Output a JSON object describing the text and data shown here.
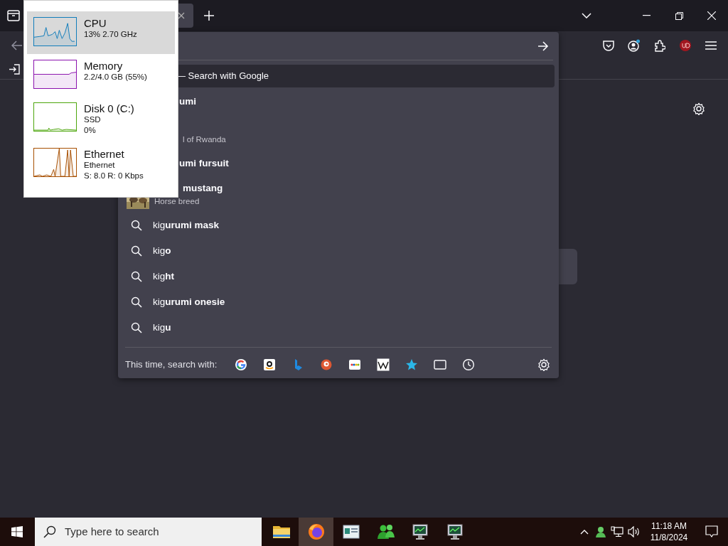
{
  "address_dropdown": {
    "heading": "— Search with Google",
    "results": [
      {
        "kind": "partial",
        "title": "umi"
      },
      {
        "kind": "partial",
        "subtitle": "l of Rwanda"
      },
      {
        "kind": "partial",
        "title": "umi fursuit"
      },
      {
        "kind": "entity",
        "title": "mustang",
        "subtitle": "Horse breed"
      },
      {
        "kind": "suggestion",
        "text": "kig**urumi mask**"
      },
      {
        "kind": "suggestion",
        "text": "kig**o**"
      },
      {
        "kind": "suggestion",
        "text": "kig**ht**"
      },
      {
        "kind": "suggestion",
        "text": "kig**urumi onesie**"
      },
      {
        "kind": "suggestion",
        "text": "kig**u**"
      }
    ],
    "footer_label": "This time, search with:",
    "engines": [
      {
        "kind": "google"
      },
      {
        "kind": "amazon"
      },
      {
        "kind": "bing"
      },
      {
        "kind": "duck"
      },
      {
        "kind": "ebay"
      },
      {
        "kind": "wiki"
      },
      {
        "kind": "bookmarks"
      },
      {
        "kind": "tabs"
      },
      {
        "kind": "history"
      }
    ]
  },
  "resource_popup": {
    "items": [
      {
        "name": "CPU",
        "details": [
          "13% 2.70 GHz"
        ],
        "selected": true,
        "color": "#117dbb"
      },
      {
        "name": "Memory",
        "details": [
          "2.2/4.0 GB (55%)"
        ],
        "selected": false,
        "color": "#8b12ae"
      },
      {
        "name": "Disk 0 (C:)",
        "details": [
          "SSD",
          "0%"
        ],
        "selected": false,
        "color": "#4da60c"
      },
      {
        "name": "Ethernet",
        "details": [
          "Ethernet",
          "S: 8.0 R: 0 Kbps"
        ],
        "selected": false,
        "color": "#a74f01"
      }
    ]
  },
  "taskbar": {
    "search": {
      "placeholder": "Type here to search"
    },
    "apps": [
      {
        "kind": "folder",
        "selected": false
      },
      {
        "kind": "browser",
        "selected": true
      },
      {
        "kind": "window",
        "selected": false
      },
      {
        "kind": "people",
        "selected": false
      },
      {
        "kind": "monitor",
        "selected": false
      },
      {
        "kind": "monitor",
        "selected": false
      }
    ],
    "clock": {
      "time": "11:18 AM",
      "date": "11/8/2024"
    }
  }
}
